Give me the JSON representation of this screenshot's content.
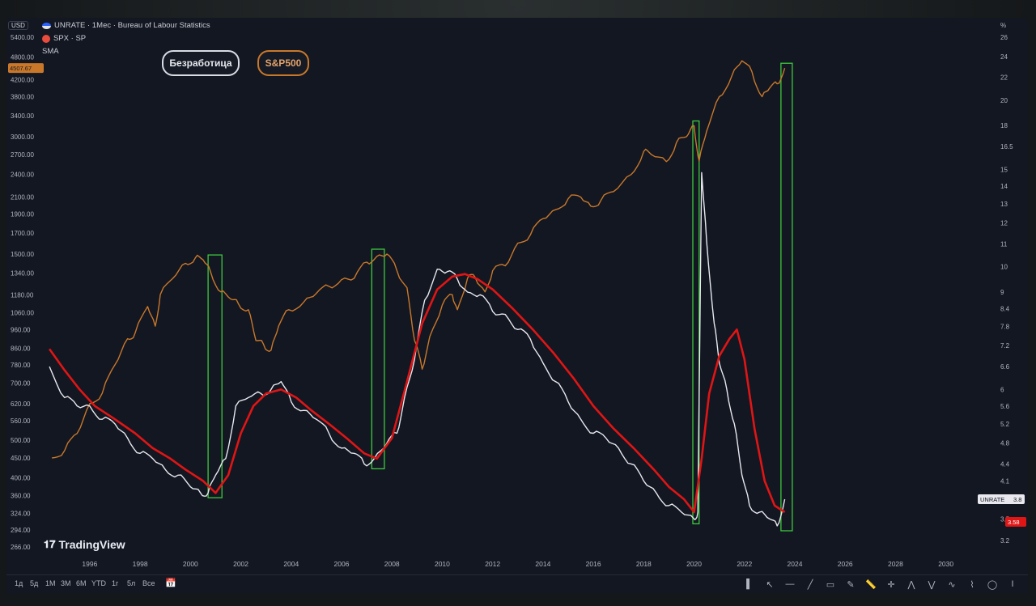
{
  "legend": {
    "currency": "USD",
    "unrate_title": "UNRATE · 1Мес · Bureau of Labour Statistics",
    "spx_title": "SPX · SP",
    "sma_label": "SMA",
    "spx_price": "4507.67"
  },
  "pills": {
    "unemployment": "Безработица",
    "spx": "S&P500"
  },
  "brand": {
    "name": "TradingView"
  },
  "colors": {
    "spx": "#c9782a",
    "unrate": "#e8e8ee",
    "sma": "#e01515",
    "box": "#3ec93e",
    "background": "#131722"
  },
  "chart_data": {
    "type": "line",
    "x_axis": {
      "range": [
        1994.3,
        2031.2
      ],
      "ticks": [
        "1996",
        "1998",
        "2000",
        "2002",
        "2004",
        "2006",
        "2008",
        "2010",
        "2012",
        "2014",
        "2016",
        "2018",
        "2020",
        "2022",
        "2024",
        "2026",
        "2028",
        "2030"
      ]
    },
    "left_axis": {
      "scale": "log",
      "ticks": [
        "5400.00",
        "4800.00",
        "4200.00",
        "3800.00",
        "3400.00",
        "3000.00",
        "2700.00",
        "2400.00",
        "2100.00",
        "1900.00",
        "1700.00",
        "1500.00",
        "1340.00",
        "1180.00",
        "1060.00",
        "960.00",
        "860.00",
        "780.00",
        "700.00",
        "620.00",
        "560.00",
        "500.00",
        "450.00",
        "400.00",
        "360.00",
        "324.00",
        "294.00",
        "266.00"
      ]
    },
    "right_axis": {
      "scale": "log",
      "unit": "%",
      "ticks": [
        "26",
        "24",
        "22",
        "20",
        "18",
        "16.5",
        "15",
        "14",
        "13",
        "12",
        "11",
        "10",
        "9",
        "8.4",
        "7.8",
        "7.2",
        "6.6",
        "6",
        "5.6",
        "5.2",
        "4.8",
        "4.4",
        "4.1",
        "3.8",
        "3.5",
        "3.2"
      ]
    },
    "series": [
      {
        "name": "SPX",
        "axis": "left",
        "x": [
          1994.5,
          1995.0,
          1995.5,
          1996.0,
          1996.5,
          1997.0,
          1997.5,
          1997.8,
          1998.3,
          1998.6,
          1998.8,
          1999.3,
          1999.8,
          2000.2,
          2000.5,
          2000.8,
          2001.2,
          2001.6,
          2001.9,
          2002.3,
          2002.6,
          2002.9,
          2003.2,
          2003.5,
          2003.9,
          2004.5,
          2005.0,
          2005.5,
          2006.0,
          2006.5,
          2007.0,
          2007.4,
          2007.8,
          2008.2,
          2008.6,
          2008.9,
          2009.2,
          2009.5,
          2010.0,
          2010.4,
          2010.6,
          2011.0,
          2011.3,
          2011.7,
          2012.0,
          2012.5,
          2013.0,
          2013.5,
          2014.0,
          2014.5,
          2015.0,
          2015.5,
          2015.9,
          2016.3,
          2016.8,
          2017.5,
          2018.0,
          2018.3,
          2018.9,
          2019.3,
          2019.7,
          2020.0,
          2020.2,
          2020.5,
          2021.0,
          2021.5,
          2021.9,
          2022.3,
          2022.7,
          2023.0,
          2023.3,
          2023.6
        ],
        "values": [
          450,
          470,
          520,
          620,
          660,
          780,
          910,
          940,
          1100,
          980,
          1180,
          1300,
          1420,
          1470,
          1450,
          1350,
          1200,
          1150,
          1120,
          1080,
          900,
          880,
          850,
          980,
          1080,
          1130,
          1190,
          1240,
          1290,
          1300,
          1430,
          1480,
          1500,
          1360,
          1230,
          900,
          760,
          920,
          1110,
          1180,
          1080,
          1300,
          1310,
          1200,
          1360,
          1400,
          1600,
          1680,
          1850,
          1950,
          2080,
          2100,
          1990,
          2060,
          2170,
          2400,
          2750,
          2700,
          2590,
          2900,
          3000,
          3200,
          2600,
          3100,
          3800,
          4300,
          4700,
          4400,
          3800,
          4000,
          4100,
          4500
        ]
      },
      {
        "name": "UNRATE",
        "axis": "right",
        "x": [
          1994.4,
          1995.0,
          1995.5,
          1996.0,
          1996.5,
          1997.0,
          1997.5,
          1998.0,
          1998.5,
          1999.0,
          1999.5,
          2000.0,
          2000.4,
          2000.7,
          2001.0,
          2001.4,
          2001.8,
          2002.3,
          2002.8,
          2003.2,
          2003.6,
          2004.0,
          2004.5,
          2005.0,
          2005.5,
          2006.0,
          2006.5,
          2006.9,
          2007.3,
          2007.8,
          2008.2,
          2008.5,
          2008.9,
          2009.3,
          2009.8,
          2010.2,
          2010.6,
          2011.0,
          2011.5,
          2012.0,
          2012.5,
          2013.0,
          2013.5,
          2014.0,
          2014.5,
          2015.0,
          2015.5,
          2016.0,
          2016.5,
          2017.0,
          2017.5,
          2018.0,
          2018.5,
          2019.0,
          2019.5,
          2020.0,
          2020.15,
          2020.3,
          2020.5,
          2020.8,
          2021.0,
          2021.3,
          2021.6,
          2021.9,
          2022.2,
          2022.6,
          2023.0,
          2023.3,
          2023.6
        ],
        "values": [
          6.6,
          5.8,
          5.6,
          5.6,
          5.3,
          5.2,
          4.9,
          4.6,
          4.5,
          4.3,
          4.2,
          4.0,
          3.9,
          3.9,
          4.2,
          4.5,
          5.6,
          5.8,
          5.9,
          6.0,
          6.2,
          5.7,
          5.5,
          5.3,
          5.0,
          4.7,
          4.6,
          4.4,
          4.5,
          4.8,
          5.0,
          5.8,
          6.8,
          8.7,
          9.9,
          9.8,
          9.5,
          9.0,
          8.9,
          8.3,
          8.2,
          7.7,
          7.4,
          6.7,
          6.2,
          5.7,
          5.3,
          5.0,
          4.9,
          4.7,
          4.4,
          4.1,
          3.9,
          3.7,
          3.6,
          3.5,
          3.6,
          14.8,
          11.1,
          7.9,
          6.7,
          6.0,
          5.2,
          4.2,
          3.7,
          3.6,
          3.5,
          3.4,
          3.8
        ]
      },
      {
        "name": "SMA",
        "axis": "right",
        "x": [
          1994.4,
          1995.0,
          1995.6,
          1996.2,
          1997.0,
          1997.8,
          1998.5,
          1999.2,
          1999.8,
          2000.5,
          2001.0,
          2001.5,
          2002.0,
          2002.5,
          2003.0,
          2003.6,
          2004.2,
          2004.8,
          2005.5,
          2006.2,
          2006.9,
          2007.4,
          2008.0,
          2008.6,
          2009.2,
          2009.8,
          2010.4,
          2010.9,
          2011.4,
          2012.0,
          2012.8,
          2013.6,
          2014.4,
          2015.2,
          2016.0,
          2016.8,
          2017.6,
          2018.4,
          2019.0,
          2019.6,
          2020.0,
          2020.3,
          2020.6,
          2021.0,
          2021.4,
          2021.7,
          2022.0,
          2022.4,
          2022.8,
          2023.2,
          2023.6
        ],
        "values": [
          7.1,
          6.5,
          6.0,
          5.6,
          5.3,
          5.0,
          4.7,
          4.5,
          4.3,
          4.1,
          3.9,
          4.2,
          5.0,
          5.6,
          5.9,
          6.0,
          5.8,
          5.5,
          5.2,
          4.9,
          4.6,
          4.5,
          4.9,
          6.2,
          7.9,
          9.1,
          9.6,
          9.7,
          9.5,
          9.1,
          8.4,
          7.7,
          7.0,
          6.3,
          5.6,
          5.1,
          4.7,
          4.3,
          4.0,
          3.8,
          3.6,
          4.5,
          5.9,
          6.9,
          7.4,
          7.7,
          6.8,
          5.1,
          4.1,
          3.7,
          3.6
        ]
      }
    ],
    "highlight_boxes": [
      {
        "x": [
          2000.7,
          2001.25
        ]
      },
      {
        "x": [
          2007.2,
          2007.7
        ]
      },
      {
        "x": [
          2019.95,
          2020.2
        ]
      },
      {
        "x": [
          2023.45,
          2023.9
        ]
      }
    ],
    "price_labels": {
      "unrate_label": "UNRATE",
      "unrate_value": "3.8",
      "sma_value": "3.58"
    }
  },
  "bottombar": {
    "timeframes": [
      "1д",
      "5д",
      "1М",
      "3М",
      "6М",
      "YTD",
      "1г",
      "5л",
      "Все"
    ],
    "tools": [
      "bars-icon",
      "cursor-icon",
      "hline-icon",
      "trend-icon",
      "rect-icon",
      "brush-icon",
      "ruler-icon",
      "crosshair-icon",
      "pattern1-icon",
      "pattern2-icon",
      "pattern3-icon",
      "pattern4-icon",
      "ellipse-icon",
      "text-icon"
    ]
  }
}
